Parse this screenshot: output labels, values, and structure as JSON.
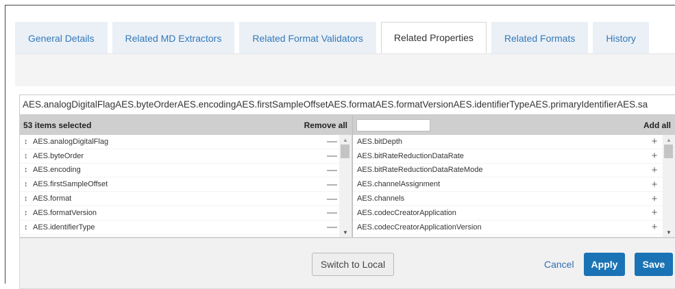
{
  "tabs": [
    {
      "label": "General Details"
    },
    {
      "label": "Related MD Extractors"
    },
    {
      "label": "Related Format Validators"
    },
    {
      "label": "Related Properties"
    },
    {
      "label": "Related Formats"
    },
    {
      "label": "History"
    }
  ],
  "active_tab": "Related Properties",
  "selected_summary": "AES.analogDigitalFlagAES.byteOrderAES.encodingAES.firstSampleOffsetAES.formatAES.formatVersionAES.identifierTypeAES.primaryIdentifierAES.sa",
  "left_list": {
    "count_label": "53 items selected",
    "remove_all_label": "Remove all",
    "remove_symbol": "—",
    "items": [
      "AES.analogDigitalFlag",
      "AES.byteOrder",
      "AES.encoding",
      "AES.firstSampleOffset",
      "AES.format",
      "AES.formatVersion",
      "AES.identifierType"
    ]
  },
  "right_list": {
    "filter_placeholder": "",
    "add_all_label": "Add all",
    "add_symbol": "+",
    "items": [
      "AES.bitDepth",
      "AES.bitRateReductionDataRate",
      "AES.bitRateReductionDataRateMode",
      "AES.channelAssignment",
      "AES.channels",
      "AES.codecCreatorApplication",
      "AES.codecCreatorApplicationVersion"
    ]
  },
  "footer": {
    "switch_label": "Switch to Local",
    "cancel_label": "Cancel",
    "apply_label": "Apply",
    "save_label": "Save"
  },
  "colors": {
    "accent": "#1a73b4",
    "tab_bg": "#eaf0f6",
    "tab_text": "#3478b8"
  }
}
